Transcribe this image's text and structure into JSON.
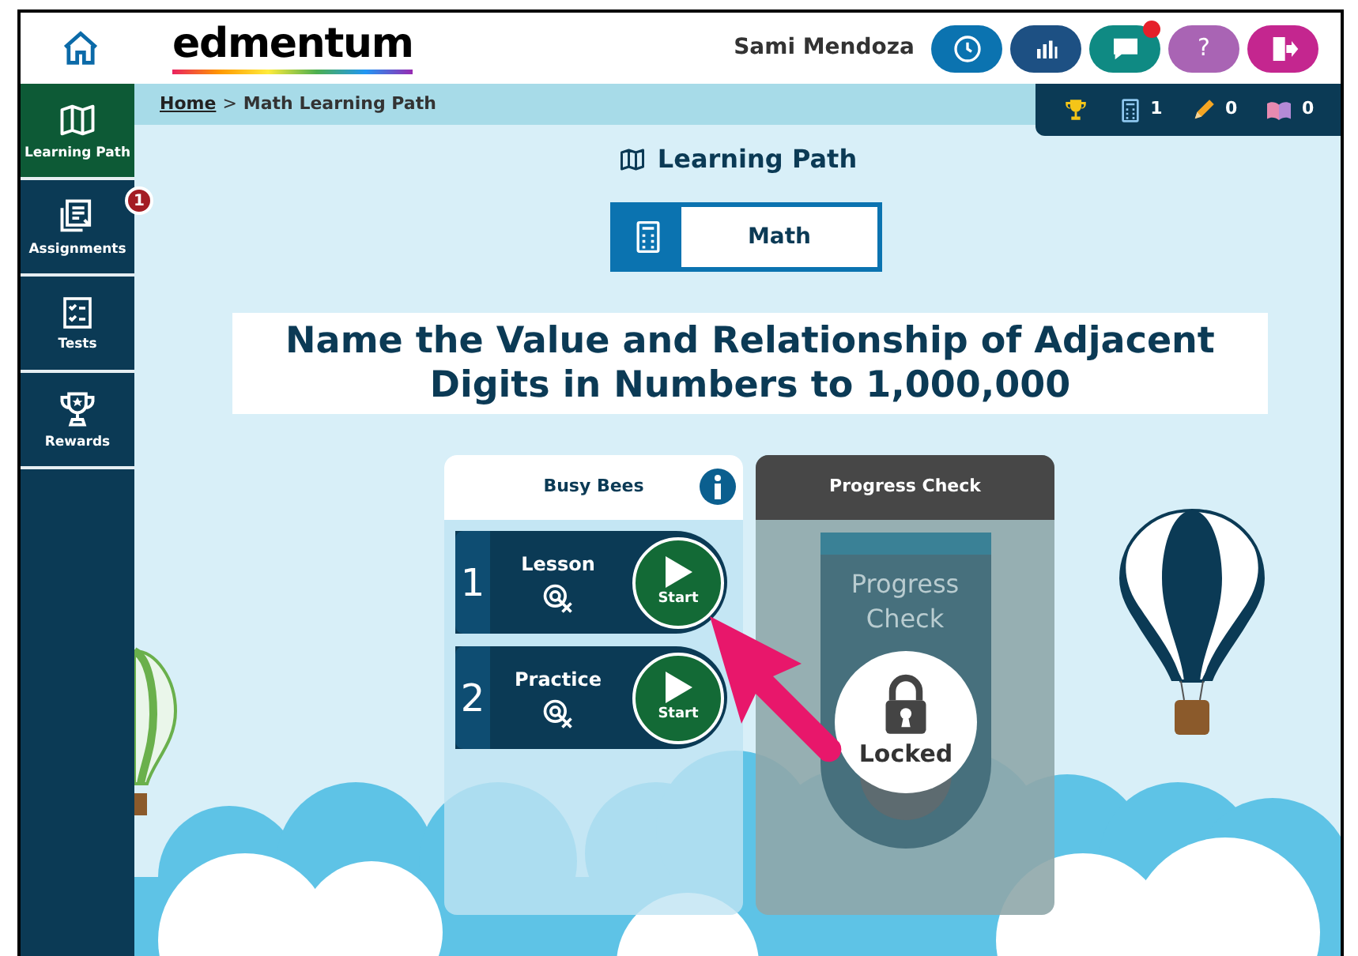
{
  "header": {
    "logo": "edmentum",
    "user_name": "Sami Mendoza",
    "buttons": [
      {
        "kind": "clock",
        "notification": false
      },
      {
        "kind": "chart",
        "notification": false
      },
      {
        "kind": "message",
        "notification": true
      },
      {
        "kind": "help",
        "label": "?",
        "notification": false
      },
      {
        "kind": "exit",
        "notification": false
      }
    ]
  },
  "sidebar": {
    "items": [
      {
        "kind": "map",
        "label": "Learning Path",
        "selected": true
      },
      {
        "kind": "assignments",
        "label": "Assignments",
        "selected": false,
        "badge": "1"
      },
      {
        "kind": "tests",
        "label": "Tests",
        "selected": false
      },
      {
        "kind": "rewards",
        "label": "Rewards",
        "selected": false
      }
    ]
  },
  "breadcrumb": {
    "link": "Home",
    "separator": ">",
    "current": "Math Learning Path"
  },
  "stats": [
    {
      "kind": "trophy"
    },
    {
      "kind": "calculator",
      "count": "1"
    },
    {
      "kind": "pencil",
      "count": "0"
    },
    {
      "kind": "book",
      "count": "0"
    }
  ],
  "page_title": "Learning Path",
  "subject": {
    "label": "Math",
    "selected": true
  },
  "heading": "Name the Value and Relationship of Adjacent Digits in Numbers to 1,000,000",
  "cards": [
    {
      "kind": "activities",
      "title": "Busy Bees",
      "locked": false,
      "activities": [
        {
          "number": "1",
          "label": "Lesson",
          "action": "Start"
        },
        {
          "number": "2",
          "label": "Practice",
          "action": "Start"
        }
      ]
    },
    {
      "kind": "check",
      "title": "Progress Check",
      "locked": true,
      "inner_title": "Progress Check",
      "lock_label": "Locked"
    }
  ]
}
